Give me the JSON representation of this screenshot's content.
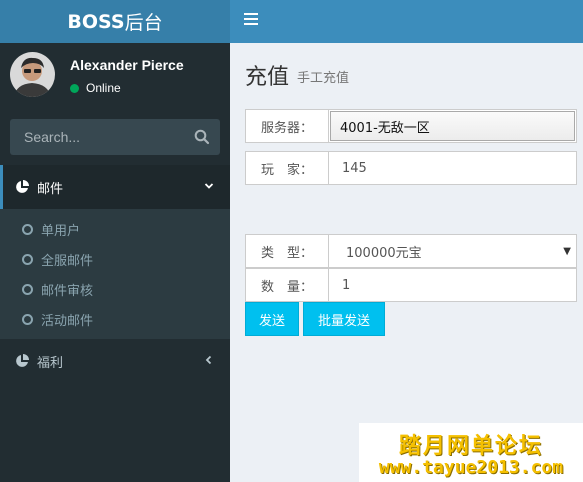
{
  "header": {
    "logo_bold": "BOSS",
    "logo_rest": "后台"
  },
  "sidebar": {
    "user": {
      "name": "Alexander Pierce",
      "status": "Online"
    },
    "search": {
      "placeholder": "Search..."
    },
    "menu": [
      {
        "label": "邮件",
        "icon": "pie-chart-icon",
        "expanded": true,
        "children": [
          "单用户",
          "全服邮件",
          "邮件审核",
          "活动邮件"
        ]
      },
      {
        "label": "福利",
        "icon": "pie-chart-icon",
        "expanded": false
      }
    ]
  },
  "content": {
    "title": "充值",
    "subtitle": "手工充值",
    "form": {
      "server_label": "服务器：",
      "server_value": "4001-无敌一区",
      "player_label": "玩　家：",
      "player_value": "145",
      "type_label": "类　型：",
      "type_value": "100000元宝",
      "quantity_label": "数　量：",
      "quantity_value": "1"
    },
    "buttons": {
      "send": "发送",
      "batch_send": "批量发送"
    }
  },
  "watermark": {
    "line1": "踏月网单论坛",
    "line2": "www.tayue2013.com"
  },
  "colors": {
    "header_logo_bg": "#367fa9",
    "header_bg": "#3c8dbc",
    "sidebar_bg": "#222d32",
    "content_bg": "#ecf0f5",
    "button_bg": "#00c0ef",
    "status_online": "#00a65a"
  }
}
